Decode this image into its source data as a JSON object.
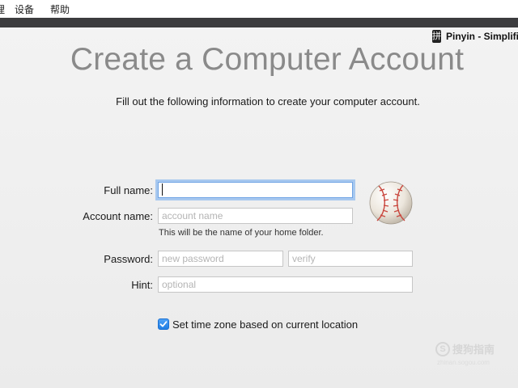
{
  "menubar": {
    "items": [
      "理",
      "设备",
      "帮助"
    ]
  },
  "input_source": {
    "glyph": "拼",
    "label": "Pinyin - Simplified"
  },
  "header": {
    "title": "Create a Computer Account",
    "subtitle": "Fill out the following information to create your computer account."
  },
  "form": {
    "full_name": {
      "label": "Full name:",
      "value": "",
      "placeholder": ""
    },
    "account_name": {
      "label": "Account name:",
      "value": "",
      "placeholder": "account name",
      "help": "This will be the name of your home folder."
    },
    "password": {
      "label": "Password:",
      "placeholder": "new password"
    },
    "verify": {
      "placeholder": "verify"
    },
    "hint": {
      "label": "Hint:",
      "placeholder": "optional"
    },
    "timezone_checkbox": {
      "label": "Set time zone based on current location",
      "checked": true
    }
  },
  "avatar": {
    "icon": "baseball-icon"
  },
  "watermark": {
    "text": "搜狗指南",
    "sub": "zhinan.sogou.com"
  },
  "colors": {
    "accent": "#2a83e8",
    "title_gray": "#8a8a8a",
    "background": "#f0f0f0"
  }
}
